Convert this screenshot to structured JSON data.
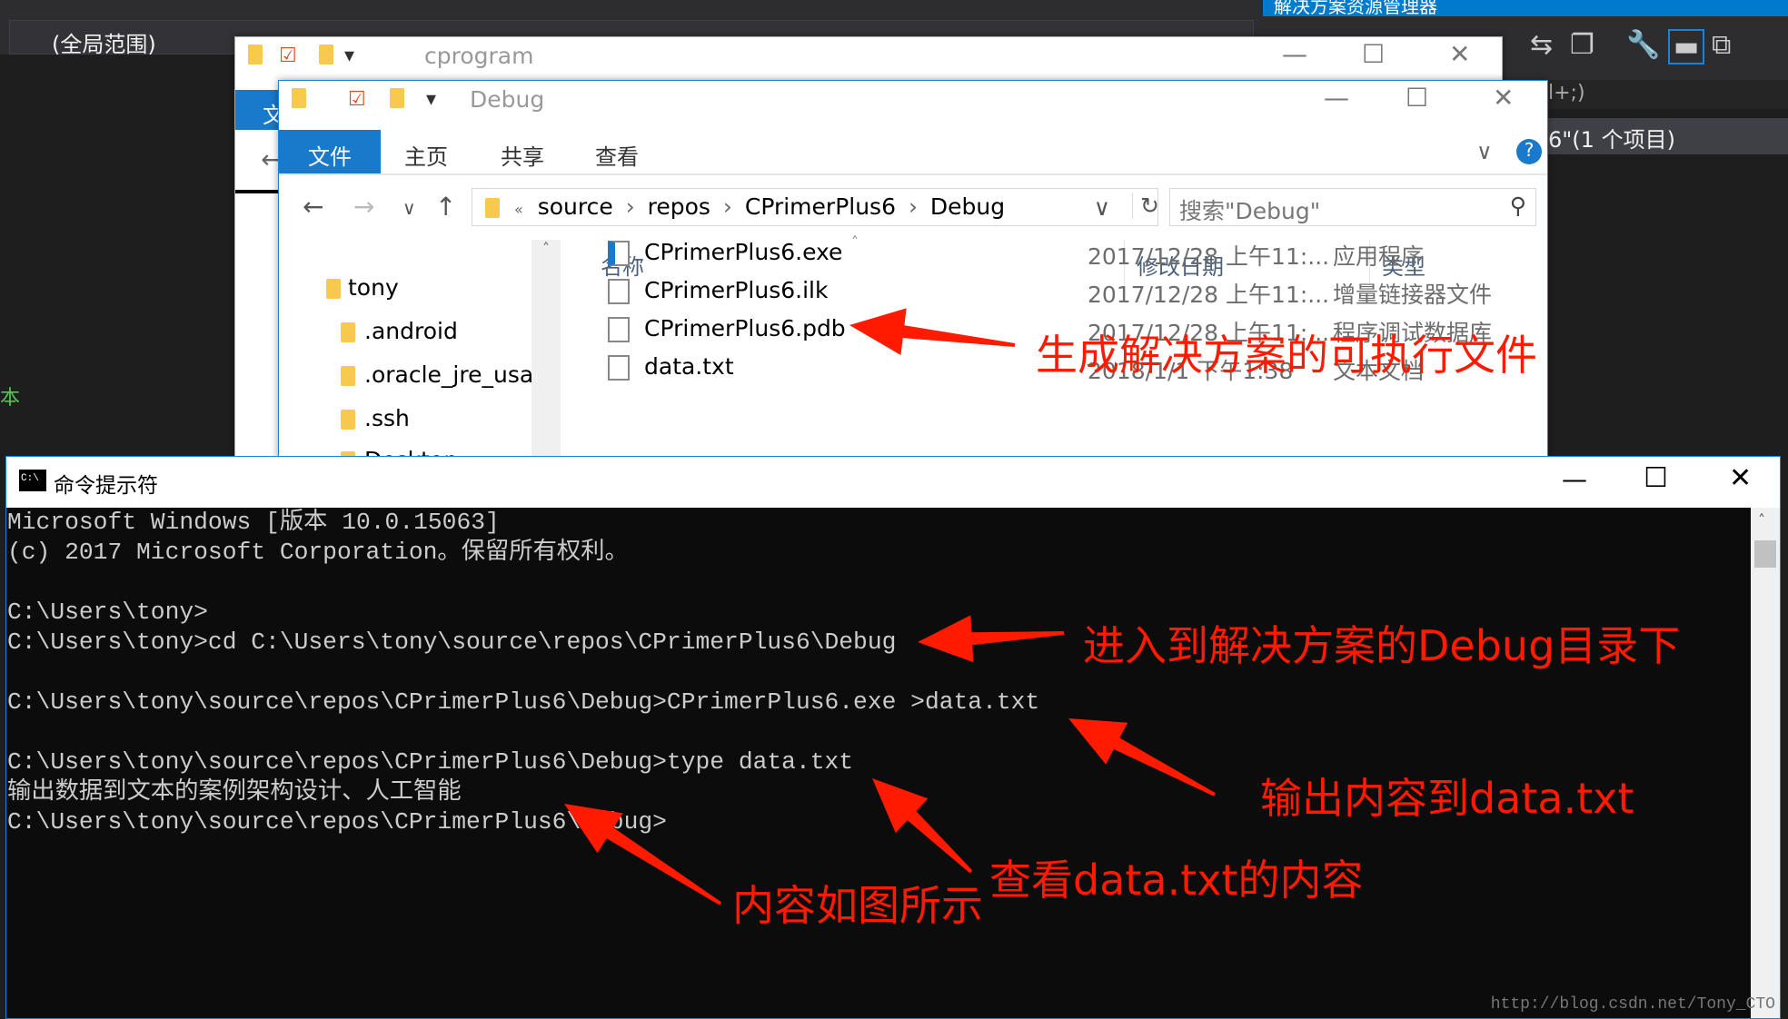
{
  "vs": {
    "scope": "(全局范围)",
    "solution_explorer": "解决方案资源管理器",
    "code_fragment": "l+;)",
    "solution_item": "6\"(1 个项目)",
    "left_text": "本"
  },
  "back_window": {
    "title": "cprogram",
    "ribbon_file": "文"
  },
  "explorer": {
    "title": "Debug",
    "tabs": [
      "文件",
      "主页",
      "共享",
      "查看"
    ],
    "breadcrumb": [
      "source",
      "repos",
      "CPrimerPlus6",
      "Debug"
    ],
    "search_placeholder": "搜索\"Debug\"",
    "nav_items": [
      "tony",
      ".android",
      ".oracle_jre_usag",
      ".ssh",
      "Desktop"
    ],
    "columns": [
      "名称",
      "修改日期",
      "类型"
    ],
    "files": [
      {
        "name": "CPrimerPlus6.exe",
        "date": "2017/12/28 上午11:...",
        "type": "应用程序",
        "icon": "exe-icon"
      },
      {
        "name": "CPrimerPlus6.ilk",
        "date": "2017/12/28 上午11:...",
        "type": "增量链接器文件",
        "icon": "ilk-file-icon"
      },
      {
        "name": "CPrimerPlus6.pdb",
        "date": "2017/12/28 上午11:...",
        "type": "程序调试数据库",
        "icon": "pdb-file-icon"
      },
      {
        "name": "data.txt",
        "date": "2018/1/1 下午1:38",
        "type": "文本文档",
        "icon": "text-file-icon"
      }
    ]
  },
  "cmd": {
    "title": "命令提示符",
    "lines": [
      "Microsoft Windows [版本 10.0.15063]",
      "(c) 2017 Microsoft Corporation。保留所有权利。",
      "",
      "C:\\Users\\tony>",
      "C:\\Users\\tony>cd C:\\Users\\tony\\source\\repos\\CPrimerPlus6\\Debug",
      "",
      "C:\\Users\\tony\\source\\repos\\CPrimerPlus6\\Debug>CPrimerPlus6.exe >data.txt",
      "",
      "C:\\Users\\tony\\source\\repos\\CPrimerPlus6\\Debug>type data.txt",
      "输出数据到文本的案例架构设计、人工智能",
      "C:\\Users\\tony\\source\\repos\\CPrimerPlus6\\Debug>"
    ]
  },
  "annotations": [
    "生成解决方案的可执行文件",
    "进入到解决方案的Debug目录下",
    "输出内容到data.txt",
    "查看data.txt的内容",
    "内容如图所示"
  ],
  "annotation_color": "#ff1a00",
  "watermark": "http://blog.csdn.net/Tony_CTO"
}
